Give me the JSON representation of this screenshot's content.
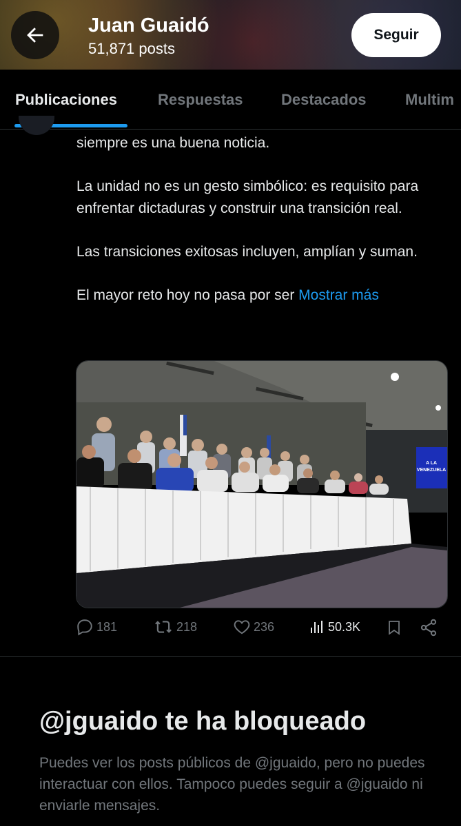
{
  "header": {
    "title": "Juan Guaidó",
    "posts_count": "51,871 posts",
    "follow_label": "Seguir",
    "icons": {
      "back": "arrow-left-icon"
    }
  },
  "tabs": [
    {
      "label": "Publicaciones",
      "active": true
    },
    {
      "label": "Respuestas",
      "active": false
    },
    {
      "label": "Destacados",
      "active": false
    },
    {
      "label": "Multim",
      "active": false
    }
  ],
  "post": {
    "paragraphs": [
      "siempre es una buena noticia.",
      "La unidad no es un gesto simbólico: es requisito para enfrentar dictaduras y construir una transición real.",
      "Las transiciones exitosas incluyen, amplían y suman."
    ],
    "last_line": "El mayor reto hoy no pasa por ser",
    "show_more": "Mostrar más",
    "image_screen_text": "A LA VENEZUELA",
    "actions": {
      "replies": "181",
      "reposts": "218",
      "likes": "236",
      "views": "50.3K"
    }
  },
  "blocked": {
    "title": "@jguaido te ha bloqueado",
    "text": "Puedes ver los posts públicos de @jguaido, pero no puedes interactuar con ellos. Tampoco puedes seguir a @jguaido ni enviarle mensajes."
  },
  "colors": {
    "accent": "#1d9bf0",
    "muted": "#71767b",
    "background": "#000000"
  }
}
